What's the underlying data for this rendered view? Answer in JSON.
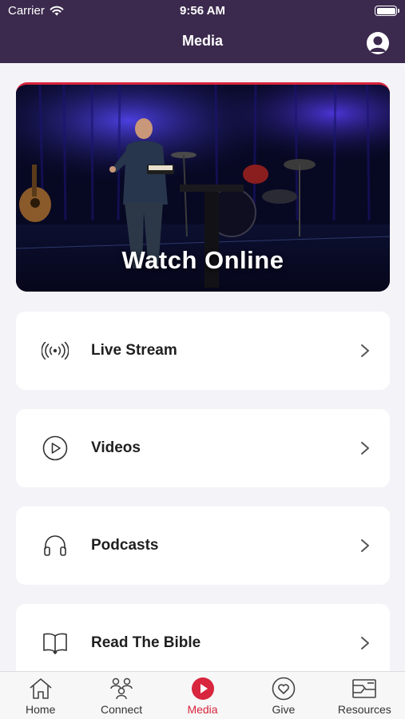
{
  "status_bar": {
    "carrier": "Carrier",
    "time": "9:56 AM"
  },
  "header": {
    "title": "Media"
  },
  "hero": {
    "title": "Watch Online"
  },
  "menu": [
    {
      "label": "Live Stream",
      "icon": "broadcast-icon"
    },
    {
      "label": "Videos",
      "icon": "play-circle-icon"
    },
    {
      "label": "Podcasts",
      "icon": "headphones-icon"
    },
    {
      "label": "Read The Bible",
      "icon": "open-book-icon"
    }
  ],
  "tabs": [
    {
      "label": "Home",
      "icon": "home-icon",
      "active": false
    },
    {
      "label": "Connect",
      "icon": "people-icon",
      "active": false
    },
    {
      "label": "Media",
      "icon": "play-icon",
      "active": true
    },
    {
      "label": "Give",
      "icon": "heart-icon",
      "active": false
    },
    {
      "label": "Resources",
      "icon": "resources-icon",
      "active": false
    }
  ],
  "colors": {
    "header_bg": "#3b2a4d",
    "accent": "#d7263d",
    "background": "#f4f4f8"
  }
}
